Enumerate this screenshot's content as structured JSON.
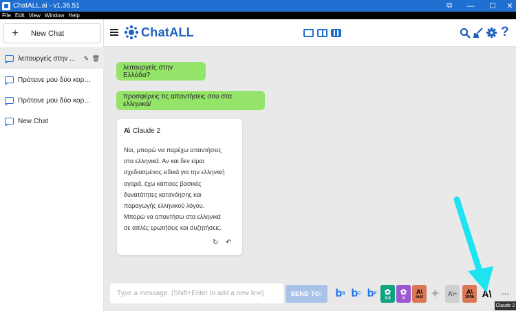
{
  "window": {
    "title": "ChatALL.ai - v1.36.51",
    "controls": [
      "⧉",
      "—",
      "☐",
      "✕"
    ]
  },
  "menubar": [
    "File",
    "Edit",
    "View",
    "Window",
    "Help"
  ],
  "sidebar": {
    "new_chat_label": "New Chat",
    "items": [
      {
        "label": "λειτουργείς στην ..."
      },
      {
        "label": "Πρότεινε μου δύο κορυφαί..."
      },
      {
        "label": "Πρότεινε μου δύο κορυφαί..."
      },
      {
        "label": "New Chat"
      }
    ]
  },
  "header": {
    "logo_text": "ChatALL"
  },
  "conversation": {
    "user_messages": [
      "λειτουργείς στην Ελλάδα?",
      "προσφέρεις τις απαντήσεις σου στα ελληνικά/"
    ],
    "response": {
      "bot_name": "Claude 2",
      "lines": [
        "Ναι, μπορώ να παρέχω απαντήσεις",
        "στα ελληνικά. Αν και δεν είμαι",
        "σχεδιασμένος ειδικά για την ελληνική",
        "αγορά, έχω κάποιες βασικές",
        "δυνατότητες κατανόησης και",
        "παραγωγής ελληνικού λόγου.",
        "Μπορώ να απαντήσω στα ελληνικά",
        "σε απλές ερωτήσεις και συζητήσεις."
      ]
    }
  },
  "footer": {
    "input_placeholder": "Type a message. (Shift+Enter to add a new line)",
    "send_label": "SEND TO:",
    "bots": [
      {
        "name": "bing-balanced",
        "text": "b",
        "sub": "B",
        "color": "#1a73e8"
      },
      {
        "name": "bing-creative",
        "text": "b",
        "sub": "C",
        "color": "#1a73e8"
      },
      {
        "name": "bing-precise",
        "text": "b",
        "sub": "P",
        "color": "#1a73e8"
      },
      {
        "name": "chatgpt-3.5",
        "text": "✿",
        "sub": "3.5",
        "color": "#10a37f"
      },
      {
        "name": "chatgpt-4",
        "text": "✿",
        "sub": "4",
        "color": "#9b59d0"
      },
      {
        "name": "claude-instant",
        "text": "A\\",
        "sub": "inst",
        "color": "#d97757"
      },
      {
        "name": "bard",
        "text": "✦",
        "sub": "",
        "color": "#b0b0b0"
      },
      {
        "name": "claude-plus",
        "text": "A\\",
        "sub": "+",
        "color": "#bdbdbd"
      },
      {
        "name": "claude-100k",
        "text": "A\\",
        "sub": "100k",
        "color": "#d97757"
      },
      {
        "name": "claude-2",
        "text": "A\\",
        "sub": "",
        "color": "#e9e9e9"
      }
    ],
    "more_label": "...",
    "tooltip": "Claude 2"
  },
  "colors": {
    "accent": "#1f6fd1",
    "user_bubble": "#95e46a",
    "annotation_arrow": "#1ee3f0"
  }
}
